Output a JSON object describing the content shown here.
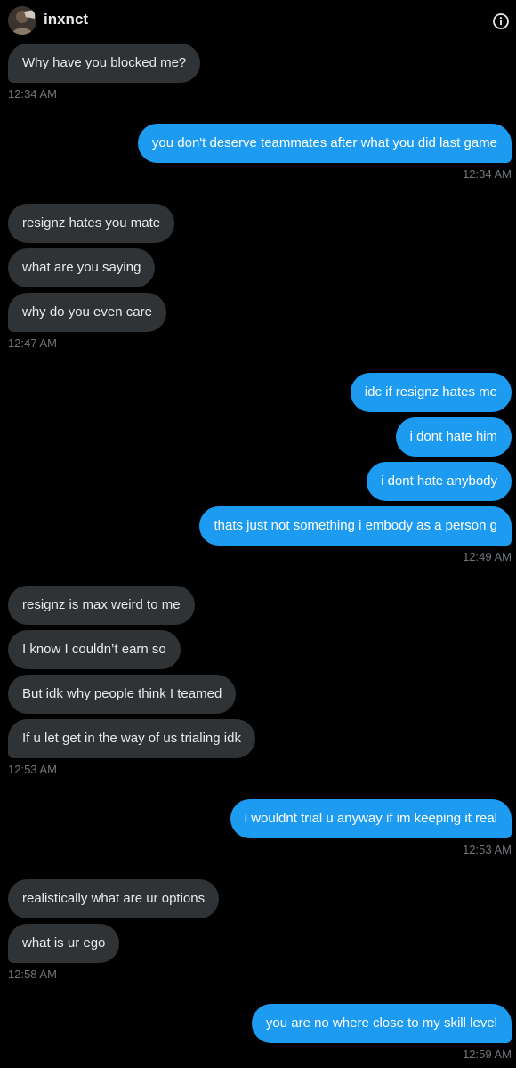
{
  "header": {
    "username": "inxnct",
    "avatar_icon": "user-avatar",
    "info_icon": "info-circle-icon"
  },
  "colors": {
    "background": "#000000",
    "incoming_bubble": "#2f3336",
    "outgoing_bubble": "#1d9bf0",
    "text": "#e7e9ea",
    "timestamp": "#71767b"
  },
  "conversation": {
    "groups": [
      {
        "direction": "incoming",
        "messages": [
          "Why have you blocked me?"
        ],
        "time": "12:34 AM"
      },
      {
        "direction": "outgoing",
        "messages": [
          "you don't deserve teammates after what you did last game"
        ],
        "time": "12:34 AM"
      },
      {
        "direction": "incoming",
        "messages": [
          "resignz hates you mate",
          "what are you saying",
          "why do you even care"
        ],
        "time": "12:47 AM"
      },
      {
        "direction": "outgoing",
        "messages": [
          "idc if resignz hates me",
          "i dont hate him",
          "i dont hate anybody",
          "thats just not something i embody as a person g"
        ],
        "time": "12:49 AM"
      },
      {
        "direction": "incoming",
        "messages": [
          "resignz is max weird to me",
          "I know I couldn’t earn so",
          "But idk why people think I teamed",
          "If u let get in the way of us trialing idk"
        ],
        "time": "12:53 AM"
      },
      {
        "direction": "outgoing",
        "messages": [
          "i wouldnt trial u anyway if im keeping it real"
        ],
        "time": "12:53 AM"
      },
      {
        "direction": "incoming",
        "messages": [
          "realistically what are ur options",
          "what is ur ego"
        ],
        "time": "12:58 AM"
      },
      {
        "direction": "outgoing",
        "messages": [
          "you are no where close to my skill level"
        ],
        "time": "12:59 AM"
      }
    ]
  }
}
